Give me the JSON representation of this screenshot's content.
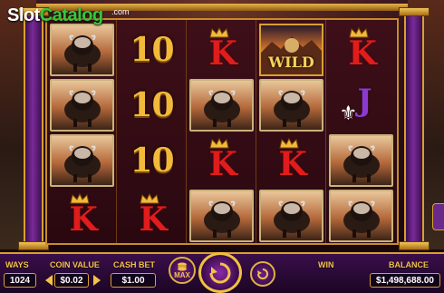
{
  "logo": {
    "brand_white": "Slot",
    "brand_green": "Catalog",
    "suffix": ".com"
  },
  "reels": {
    "wild_label": "WILD",
    "ten_label": "10",
    "k_label": "K",
    "j_label": "J"
  },
  "controls": {
    "ways_label": "WAYS",
    "ways_value": "1024",
    "coin_value_label": "COIN VALUE",
    "coin_value": "$0.02",
    "cash_bet_label": "CASH BET",
    "cash_bet_value": "$1.00",
    "max_label": "MAX",
    "win_label": "WIN",
    "win_value": "",
    "balance_label": "BALANCE",
    "balance_value": "$1,498,688.00"
  },
  "colors": {
    "gold": "#f2c24a",
    "purple": "#6a1f88",
    "king_red": "#e01c1c",
    "jack_purple": "#8a3ad1",
    "ten_gold": "#f2b93a"
  },
  "icons": [
    "bison-symbol",
    "crown-icon",
    "fleur-de-lis-icon",
    "coin-stack-icon",
    "spin-arrow-icon",
    "autoplay-icon"
  ]
}
